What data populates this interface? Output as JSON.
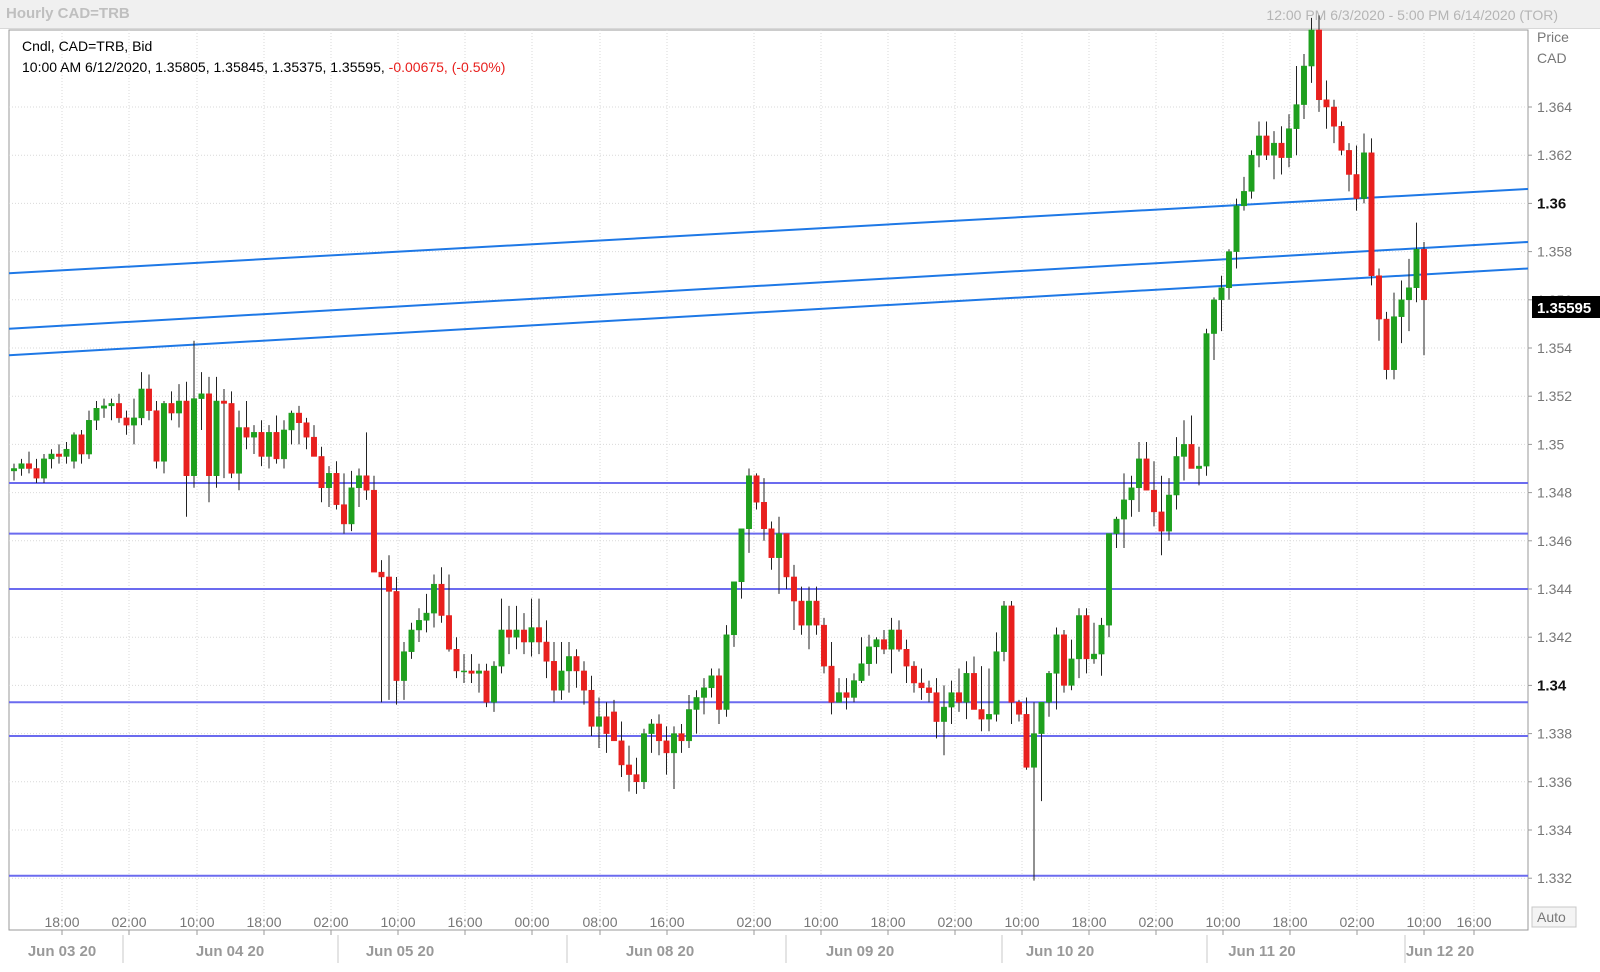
{
  "window": {
    "title_left": "Hourly CAD=TRB",
    "title_right": "12:00 PM 6/3/2020 - 5:00 PM 6/14/2020 (TOR)"
  },
  "info": {
    "line1": "Cndl, CAD=TRB, Bid",
    "line2": "10:00 AM 6/12/2020, 1.35805, 1.35845, 1.35375, 1.35595,",
    "change": "-0.00675, (-0.50%)"
  },
  "axis": {
    "price_title": "Price",
    "currency": "CAD",
    "auto_label": "Auto",
    "last_price_label": "1.35595"
  },
  "colors": {
    "up": "#1ea01e",
    "down": "#e8201e",
    "trendline": "#1e78e6",
    "hline": "#6b6bef",
    "grid": "#d9d9d9"
  },
  "chart_data": {
    "type": "candlestick",
    "ylim": [
      1.3305,
      1.3665
    ],
    "y_ticks": [
      "1.364",
      "1.362",
      "1.36",
      "1.358",
      "1.356",
      "1.354",
      "1.352",
      "1.35",
      "1.348",
      "1.346",
      "1.344",
      "1.342",
      "1.34",
      "1.338",
      "1.336",
      "1.334",
      "1.332"
    ],
    "time_ticks": [
      "18:00",
      "02:00",
      "10:00",
      "18:00",
      "02:00",
      "10:00",
      "16:00",
      "00:00",
      "08:00",
      "16:00",
      "02:00",
      "10:00",
      "18:00",
      "02:00",
      "10:00",
      "18:00",
      "02:00",
      "10:00",
      "18:00",
      "02:00",
      "10:00",
      "16:00"
    ],
    "day_labels": [
      "Jun 03 20",
      "Jun 04 20",
      "Jun 05 20",
      "Jun 08 20",
      "Jun 09 20",
      "Jun 10 20",
      "Jun 11 20",
      "Jun 12 20"
    ],
    "horizontal_lines": [
      1.3484,
      1.3463,
      1.344,
      1.3393,
      1.3379,
      1.3321
    ],
    "trendlines": [
      {
        "y_start": 1.3571,
        "y_end": 1.3606
      },
      {
        "y_start": 1.3548,
        "y_end": 1.3584
      },
      {
        "y_start": 1.3537,
        "y_end": 1.3573
      }
    ],
    "ohlc": [
      [
        1.3489,
        1.3492,
        1.3485,
        1.349
      ],
      [
        1.349,
        1.3494,
        1.3487,
        1.3492
      ],
      [
        1.3492,
        1.3497,
        1.3488,
        1.349
      ],
      [
        1.349,
        1.3494,
        1.3484,
        1.3486
      ],
      [
        1.3486,
        1.3496,
        1.3484,
        1.3494
      ],
      [
        1.3494,
        1.3498,
        1.349,
        1.3496
      ],
      [
        1.3496,
        1.35,
        1.3492,
        1.3495
      ],
      [
        1.3495,
        1.3501,
        1.3492,
        1.3498
      ],
      [
        1.3493,
        1.3505,
        1.349,
        1.3504
      ],
      [
        1.3504,
        1.3506,
        1.3492,
        1.3496
      ],
      [
        1.3496,
        1.3514,
        1.3494,
        1.351
      ],
      [
        1.351,
        1.3518,
        1.3506,
        1.3515
      ],
      [
        1.3515,
        1.3519,
        1.3511,
        1.3516
      ],
      [
        1.3516,
        1.3519,
        1.351,
        1.3517
      ],
      [
        1.3517,
        1.3521,
        1.3509,
        1.3511
      ],
      [
        1.3511,
        1.3514,
        1.3504,
        1.3508
      ],
      [
        1.3508,
        1.3519,
        1.35,
        1.3511
      ],
      [
        1.3511,
        1.353,
        1.3508,
        1.3523
      ],
      [
        1.3523,
        1.3529,
        1.351,
        1.3514
      ],
      [
        1.3514,
        1.3518,
        1.349,
        1.3493
      ],
      [
        1.3493,
        1.3518,
        1.3488,
        1.3517
      ],
      [
        1.3517,
        1.3522,
        1.351,
        1.3513
      ],
      [
        1.3513,
        1.3525,
        1.3507,
        1.3518
      ],
      [
        1.3518,
        1.3526,
        1.347,
        1.3487
      ],
      [
        1.3487,
        1.3543,
        1.3482,
        1.3519
      ],
      [
        1.3519,
        1.353,
        1.3506,
        1.3521
      ],
      [
        1.3521,
        1.3528,
        1.3476,
        1.3487
      ],
      [
        1.3487,
        1.3528,
        1.3482,
        1.3518
      ],
      [
        1.3518,
        1.3523,
        1.3486,
        1.3517
      ],
      [
        1.3517,
        1.3522,
        1.3486,
        1.3488
      ],
      [
        1.3488,
        1.3514,
        1.3481,
        1.3507
      ],
      [
        1.3507,
        1.3518,
        1.3498,
        1.3503
      ],
      [
        1.3503,
        1.3508,
        1.3496,
        1.3505
      ],
      [
        1.3505,
        1.351,
        1.3491,
        1.3495
      ],
      [
        1.3495,
        1.3508,
        1.349,
        1.3505
      ],
      [
        1.3505,
        1.3512,
        1.3492,
        1.3494
      ],
      [
        1.3494,
        1.351,
        1.349,
        1.3506
      ],
      [
        1.3506,
        1.3514,
        1.35,
        1.3513
      ],
      [
        1.3513,
        1.3516,
        1.35,
        1.3509
      ],
      [
        1.3509,
        1.3511,
        1.3498,
        1.3503
      ],
      [
        1.3503,
        1.3508,
        1.3495,
        1.3495
      ],
      [
        1.3495,
        1.3499,
        1.3476,
        1.3482
      ],
      [
        1.3482,
        1.3491,
        1.3474,
        1.3488
      ],
      [
        1.3488,
        1.3493,
        1.3473,
        1.3475
      ],
      [
        1.3475,
        1.3488,
        1.3463,
        1.3467
      ],
      [
        1.3467,
        1.3489,
        1.3464,
        1.3482
      ],
      [
        1.3482,
        1.349,
        1.3474,
        1.3487
      ],
      [
        1.3487,
        1.3505,
        1.3477,
        1.3481
      ],
      [
        1.3481,
        1.3487,
        1.3452,
        1.3447
      ],
      [
        1.3447,
        1.3452,
        1.3393,
        1.3445
      ],
      [
        1.3445,
        1.3454,
        1.3394,
        1.3439
      ],
      [
        1.3439,
        1.3445,
        1.3392,
        1.3402
      ],
      [
        1.3402,
        1.3418,
        1.3394,
        1.3414
      ],
      [
        1.3414,
        1.3426,
        1.3411,
        1.3423
      ],
      [
        1.3423,
        1.3432,
        1.3418,
        1.3427
      ],
      [
        1.3427,
        1.3438,
        1.3422,
        1.343
      ],
      [
        1.343,
        1.3446,
        1.3424,
        1.3442
      ],
      [
        1.3442,
        1.3449,
        1.3426,
        1.3429
      ],
      [
        1.3429,
        1.3446,
        1.3414,
        1.3415
      ],
      [
        1.3415,
        1.342,
        1.3403,
        1.3406
      ],
      [
        1.3406,
        1.3413,
        1.3401,
        1.3406
      ],
      [
        1.3406,
        1.3413,
        1.3401,
        1.3405
      ],
      [
        1.3405,
        1.3409,
        1.3397,
        1.3406
      ],
      [
        1.3406,
        1.3409,
        1.3391,
        1.3393
      ],
      [
        1.3393,
        1.341,
        1.3389,
        1.3408
      ],
      [
        1.3408,
        1.3436,
        1.3405,
        1.3423
      ],
      [
        1.3423,
        1.3433,
        1.3413,
        1.342
      ],
      [
        1.342,
        1.3433,
        1.3415,
        1.3423
      ],
      [
        1.3423,
        1.343,
        1.3413,
        1.3418
      ],
      [
        1.3418,
        1.3436,
        1.3412,
        1.3424
      ],
      [
        1.3424,
        1.3436,
        1.3413,
        1.3418
      ],
      [
        1.3418,
        1.3427,
        1.3403,
        1.341
      ],
      [
        1.341,
        1.3418,
        1.3393,
        1.3398
      ],
      [
        1.3398,
        1.3418,
        1.3394,
        1.3406
      ],
      [
        1.3406,
        1.3418,
        1.3397,
        1.3412
      ],
      [
        1.3412,
        1.3415,
        1.3399,
        1.3406
      ],
      [
        1.3406,
        1.341,
        1.3392,
        1.3398
      ],
      [
        1.3398,
        1.3404,
        1.3379,
        1.3383
      ],
      [
        1.3383,
        1.3395,
        1.3374,
        1.3387
      ],
      [
        1.3387,
        1.3393,
        1.3372,
        1.338
      ],
      [
        1.3389,
        1.3394,
        1.3377,
        1.3377
      ],
      [
        1.3377,
        1.3385,
        1.3362,
        1.3367
      ],
      [
        1.3367,
        1.3375,
        1.3356,
        1.3363
      ],
      [
        1.3363,
        1.337,
        1.3355,
        1.336
      ],
      [
        1.336,
        1.3382,
        1.3357,
        1.338
      ],
      [
        1.338,
        1.3386,
        1.3372,
        1.3384
      ],
      [
        1.3384,
        1.3388,
        1.3371,
        1.3377
      ],
      [
        1.3377,
        1.3383,
        1.3363,
        1.3372
      ],
      [
        1.3372,
        1.3383,
        1.3357,
        1.338
      ],
      [
        1.338,
        1.3384,
        1.3372,
        1.3377
      ],
      [
        1.3377,
        1.3396,
        1.3374,
        1.339
      ],
      [
        1.339,
        1.3398,
        1.338,
        1.3395
      ],
      [
        1.3395,
        1.3403,
        1.3388,
        1.3399
      ],
      [
        1.3399,
        1.3407,
        1.3395,
        1.3404
      ],
      [
        1.3404,
        1.3407,
        1.3384,
        1.339
      ],
      [
        1.339,
        1.3425,
        1.3387,
        1.3421
      ],
      [
        1.3421,
        1.3438,
        1.3416,
        1.3443
      ],
      [
        1.3443,
        1.346,
        1.3436,
        1.3465
      ],
      [
        1.3465,
        1.349,
        1.3455,
        1.3487
      ],
      [
        1.3487,
        1.3488,
        1.3473,
        1.3476
      ],
      [
        1.3476,
        1.3486,
        1.346,
        1.3465
      ],
      [
        1.3465,
        1.3468,
        1.3448,
        1.3453
      ],
      [
        1.3453,
        1.347,
        1.3438,
        1.3463
      ],
      [
        1.3463,
        1.3463,
        1.344,
        1.3445
      ],
      [
        1.3445,
        1.345,
        1.3423,
        1.3435
      ],
      [
        1.3435,
        1.3441,
        1.3421,
        1.3425
      ],
      [
        1.3425,
        1.3441,
        1.3415,
        1.3435
      ],
      [
        1.3435,
        1.3441,
        1.3421,
        1.3425
      ],
      [
        1.3425,
        1.3428,
        1.3405,
        1.3408
      ],
      [
        1.3408,
        1.3418,
        1.3388,
        1.3393
      ],
      [
        1.3393,
        1.3403,
        1.3393,
        1.3397
      ],
      [
        1.3397,
        1.3403,
        1.339,
        1.3395
      ],
      [
        1.3395,
        1.3405,
        1.3393,
        1.3402
      ],
      [
        1.3402,
        1.342,
        1.3401,
        1.3409
      ],
      [
        1.3409,
        1.3421,
        1.3404,
        1.3416
      ],
      [
        1.3416,
        1.342,
        1.3409,
        1.3419
      ],
      [
        1.3419,
        1.3423,
        1.3413,
        1.3415
      ],
      [
        1.3415,
        1.3428,
        1.3405,
        1.3423
      ],
      [
        1.3423,
        1.3427,
        1.3414,
        1.3415
      ],
      [
        1.3415,
        1.3419,
        1.3401,
        1.3408
      ],
      [
        1.3408,
        1.341,
        1.3397,
        1.3401
      ],
      [
        1.3401,
        1.3407,
        1.3394,
        1.3399
      ],
      [
        1.3399,
        1.3402,
        1.3393,
        1.3397
      ],
      [
        1.3397,
        1.3403,
        1.3378,
        1.3385
      ],
      [
        1.3385,
        1.34,
        1.3371,
        1.3391
      ],
      [
        1.3391,
        1.3402,
        1.3384,
        1.3397
      ],
      [
        1.3397,
        1.3407,
        1.3389,
        1.3393
      ],
      [
        1.3393,
        1.341,
        1.3386,
        1.3405
      ],
      [
        1.3405,
        1.3412,
        1.3394,
        1.339
      ],
      [
        1.339,
        1.3408,
        1.3381,
        1.3386
      ],
      [
        1.3386,
        1.3407,
        1.3381,
        1.3388
      ],
      [
        1.3388,
        1.3422,
        1.3385,
        1.3414
      ],
      [
        1.3414,
        1.3435,
        1.341,
        1.3433
      ],
      [
        1.3433,
        1.3435,
        1.3384,
        1.3393
      ],
      [
        1.3393,
        1.3394,
        1.3385,
        1.3388
      ],
      [
        1.3388,
        1.3395,
        1.3365,
        1.3366
      ],
      [
        1.3366,
        1.3393,
        1.3319,
        1.338
      ],
      [
        1.338,
        1.3386,
        1.3352,
        1.3393
      ],
      [
        1.3393,
        1.3406,
        1.3387,
        1.3405
      ],
      [
        1.3405,
        1.3424,
        1.339,
        1.3421
      ],
      [
        1.3421,
        1.3423,
        1.3397,
        1.34
      ],
      [
        1.34,
        1.3419,
        1.3398,
        1.3411
      ],
      [
        1.3411,
        1.3432,
        1.3403,
        1.3429
      ],
      [
        1.3429,
        1.3432,
        1.3405,
        1.3411
      ],
      [
        1.3411,
        1.3426,
        1.3409,
        1.3413
      ],
      [
        1.3413,
        1.3428,
        1.3404,
        1.3425
      ],
      [
        1.3425,
        1.3445,
        1.342,
        1.3463
      ],
      [
        1.3463,
        1.347,
        1.3457,
        1.3469
      ],
      [
        1.3469,
        1.3488,
        1.3457,
        1.3477
      ],
      [
        1.3477,
        1.3487,
        1.347,
        1.3482
      ],
      [
        1.3482,
        1.3501,
        1.3472,
        1.3494
      ],
      [
        1.3494,
        1.3501,
        1.3481,
        1.3481
      ],
      [
        1.3481,
        1.3493,
        1.3466,
        1.3472
      ],
      [
        1.3472,
        1.3487,
        1.3454,
        1.3464
      ],
      [
        1.3464,
        1.3486,
        1.346,
        1.3479
      ],
      [
        1.3479,
        1.3503,
        1.3473,
        1.3495
      ],
      [
        1.3495,
        1.351,
        1.3485,
        1.35
      ],
      [
        1.35,
        1.3512,
        1.3495,
        1.349
      ],
      [
        1.349,
        1.3499,
        1.3483,
        1.3491
      ],
      [
        1.3491,
        1.3548,
        1.3487,
        1.3546
      ],
      [
        1.3546,
        1.3561,
        1.3535,
        1.356
      ],
      [
        1.356,
        1.357,
        1.3547,
        1.3565
      ],
      [
        1.3565,
        1.3581,
        1.356,
        1.358
      ],
      [
        1.358,
        1.3602,
        1.3573,
        1.3599
      ],
      [
        1.3599,
        1.3611,
        1.3597,
        1.3605
      ],
      [
        1.3605,
        1.3622,
        1.3602,
        1.362
      ],
      [
        1.362,
        1.3634,
        1.3615,
        1.3628
      ],
      [
        1.3628,
        1.3634,
        1.3618,
        1.362
      ],
      [
        1.362,
        1.363,
        1.361,
        1.3625
      ],
      [
        1.3625,
        1.3632,
        1.3612,
        1.3619
      ],
      [
        1.3619,
        1.3637,
        1.3615,
        1.3631
      ],
      [
        1.3631,
        1.3657,
        1.362,
        1.3641
      ],
      [
        1.3641,
        1.3662,
        1.3635,
        1.3657
      ],
      [
        1.3657,
        1.3677,
        1.365,
        1.3672
      ],
      [
        1.3672,
        1.3678,
        1.3638,
        1.3643
      ],
      [
        1.3643,
        1.3651,
        1.3631,
        1.364
      ],
      [
        1.364,
        1.3643,
        1.3625,
        1.3632
      ],
      [
        1.3632,
        1.3634,
        1.362,
        1.3622
      ],
      [
        1.3622,
        1.3625,
        1.3605,
        1.3612
      ],
      [
        1.3612,
        1.3624,
        1.3597,
        1.3602
      ],
      [
        1.3602,
        1.3629,
        1.36,
        1.3621
      ],
      [
        1.3621,
        1.3627,
        1.3566,
        1.357
      ],
      [
        1.357,
        1.3573,
        1.3543,
        1.3552
      ],
      [
        1.3552,
        1.3555,
        1.3527,
        1.3531
      ],
      [
        1.3531,
        1.3563,
        1.3527,
        1.3553
      ],
      [
        1.3553,
        1.3568,
        1.3542,
        1.356
      ],
      [
        1.356,
        1.3577,
        1.3547,
        1.3565
      ],
      [
        1.3565,
        1.3592,
        1.3559,
        1.3581
      ],
      [
        1.3581,
        1.3584,
        1.3537,
        1.356
      ]
    ]
  }
}
